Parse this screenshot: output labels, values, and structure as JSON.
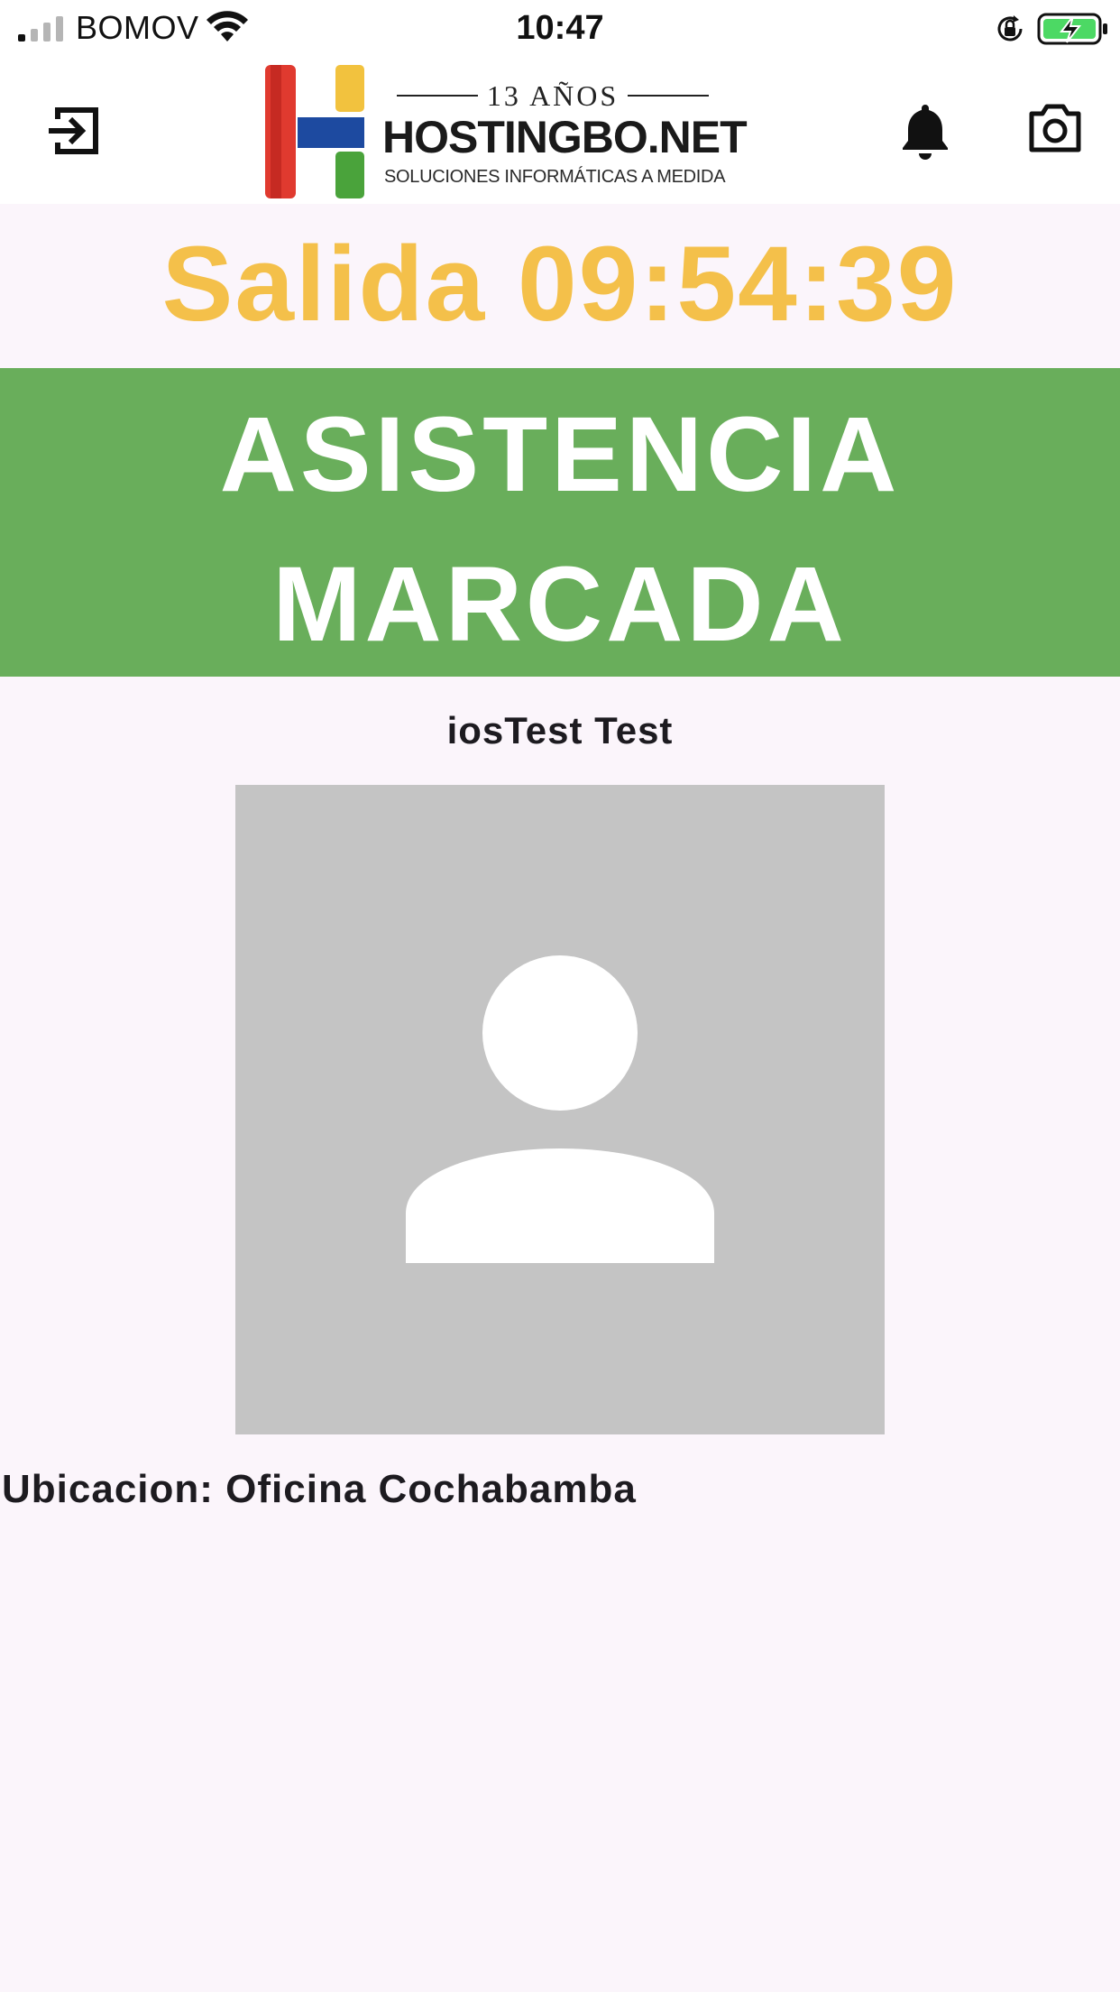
{
  "status_bar": {
    "carrier": "BOMOV",
    "time": "10:47",
    "signal_icon": "cellular-signal-icon",
    "wifi_icon": "wifi-icon",
    "orientation_icon": "orientation-lock-icon",
    "battery_icon": "battery-charging-icon",
    "battery_color": "#4cd964"
  },
  "app_bar": {
    "logout_icon": "logout-icon",
    "notifications_icon": "bell-icon",
    "camera_icon": "camera-icon",
    "logo": {
      "years": "13 AÑOS",
      "name": "HOSTINGBO.NET",
      "tagline": "SOLUCIONES INFORMÁTICAS A MEDIDA"
    }
  },
  "attendance": {
    "heading": "Salida 09:54:39",
    "heading_color": "#f4c04a",
    "status_line1": "ASISTENCIA",
    "status_line2": "MARCADA",
    "status_color": "#69ae5b"
  },
  "user": {
    "name": "iosTest Test",
    "avatar_icon": "person-placeholder-icon"
  },
  "location": {
    "text": "Ubicacion: Oficina Cochabamba"
  }
}
